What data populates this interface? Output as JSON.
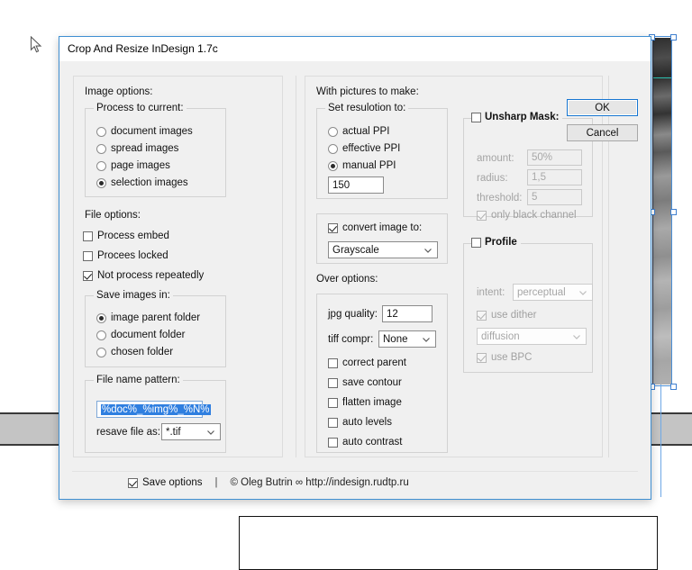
{
  "dialog": {
    "title": "Crop And Resize InDesign 1.7c",
    "buttons": {
      "ok": "OK",
      "cancel": "Cancel"
    },
    "footer": {
      "save_options_label": "Save options",
      "save_options_checked": true,
      "divider": "|",
      "credit": "© Oleg Butrin ∞ http://indesign.rudtp.ru"
    }
  },
  "image_options": {
    "section_label": "Image options:",
    "process_to_current": {
      "group_label": "Process to current:",
      "options": [
        {
          "label": "document images",
          "selected": false
        },
        {
          "label": "spread images",
          "selected": false
        },
        {
          "label": "page images",
          "selected": false
        },
        {
          "label": "selection images",
          "selected": true
        }
      ]
    },
    "file_options": {
      "section_label": "File options:",
      "checks": [
        {
          "label": "Process embed",
          "checked": false
        },
        {
          "label": "Procees locked",
          "checked": false
        },
        {
          "label": "Not process repeatedly",
          "checked": true
        }
      ]
    },
    "save_images_in": {
      "group_label": "Save images in:",
      "options": [
        {
          "label": "image parent folder",
          "selected": true
        },
        {
          "label": "document folder",
          "selected": false
        },
        {
          "label": "chosen folder",
          "selected": false
        }
      ]
    },
    "file_name_pattern": {
      "group_label": "File name pattern:",
      "value": "%doc%_%img%_%N%",
      "resave_label": "resave file as:",
      "resave_value": "*.tif"
    }
  },
  "pictures_options": {
    "section_label": "With pictures to make:",
    "set_resolution": {
      "group_label": "Set resulotion to:",
      "options": [
        {
          "label": "actual PPI",
          "selected": false
        },
        {
          "label": "effective PPI",
          "selected": false
        },
        {
          "label": "manual PPI",
          "selected": true
        }
      ],
      "manual_value": "150"
    },
    "convert_image": {
      "label": "convert image to:",
      "checked": true,
      "mode": "Grayscale"
    },
    "over_options": {
      "section_label": "Over options:",
      "jpg_quality_label": "jpg quality:",
      "jpg_quality_value": "12",
      "tiff_compr_label": "tiff compr:",
      "tiff_compr_value": "None",
      "checks": [
        {
          "label": "correct parent",
          "checked": false
        },
        {
          "label": "save contour",
          "checked": false
        },
        {
          "label": "flatten image",
          "checked": false
        },
        {
          "label": "auto levels",
          "checked": false
        },
        {
          "label": "auto contrast",
          "checked": false
        }
      ]
    }
  },
  "advanced_options": {
    "unsharp_mask": {
      "title": "Unsharp Mask:",
      "checked": false,
      "fields": [
        {
          "label": "amount:",
          "value": "50%"
        },
        {
          "label": "radius:",
          "value": "1,5"
        },
        {
          "label": "threshold:",
          "value": "5"
        }
      ],
      "only_black_channel": {
        "label": "only black channel",
        "checked": true
      }
    },
    "profile": {
      "title": "Profile",
      "checked": false,
      "intent_label": "intent:",
      "intent_value": "perceptual",
      "use_dither": {
        "label": "use dither",
        "checked": true
      },
      "dither_value": "diffusion",
      "use_bpc": {
        "label": "use BPC",
        "checked": true
      }
    }
  },
  "colors": {
    "dialog_border": "#3f8fd2",
    "dialog_face": "#f0f0f0",
    "accent_focus": "#1675d1",
    "selection_blue": "#2f7fe0",
    "frame_handle": "#3f7fcf"
  }
}
